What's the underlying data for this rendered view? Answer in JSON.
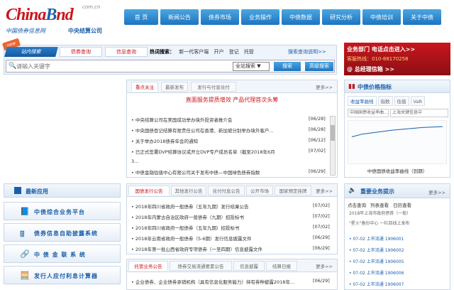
{
  "logo": {
    "main_a": "China",
    "main_b": "B",
    "main_c": "nd",
    "domain": "com.cn",
    "subtitle_left": "中国债券信息网",
    "subtitle_right": "中央结算公司"
  },
  "nav": {
    "items": [
      "首  页",
      "新闻公告",
      "债券市场",
      "业务操作",
      "中债数据",
      "研究分析",
      "中债培训",
      "关于中债"
    ]
  },
  "search": {
    "new_badge": "new",
    "tabs": [
      "站内搜索",
      "债券查询",
      "信息查询"
    ],
    "hot_label": "热词搜索：",
    "hot_terms": [
      "新一代客户端",
      "开户",
      "登记",
      "托管"
    ],
    "advanced_link": "搜索查询说明>>",
    "placeholder": "请输入关键字",
    "scope": "全站搜索 ▼",
    "search_button": "搜索",
    "advanced_button": "高级搜索"
  },
  "promo": {
    "line1": "业务部门 电话点击进入>>",
    "line2": "客服热线：010-88170258",
    "line3": "@ 总经理信箱 >>"
  },
  "apps": {
    "title": "最新应用",
    "items": [
      {
        "icon": "📘",
        "label": "中债综合业务平台"
      },
      {
        "icon": "🖩",
        "label": "债券信息自助披露系统"
      },
      {
        "icon": "🔗",
        "label": "中 债 金 联 系 统"
      },
      {
        "icon": "🧮",
        "label": "发行人应付利息计算器"
      }
    ]
  },
  "news": {
    "tabs": [
      "重点关注",
      "最新发布",
      "发行与付息兑付"
    ],
    "more": "更多>>",
    "banner": "直面服务提质增效 产品代理首次头筹",
    "rows": [
      {
        "text": "• 中央结算公司在美国成功举办境外投资者推介会",
        "date": "[06/28]"
      },
      {
        "text": "• 中央国债登记结算有限责任公司在香港、新加坡分别举办境外客户...",
        "date": "[06/28]"
      },
      {
        "text": "• 关于举办2018债券年会的通知",
        "date": "[06/12]"
      },
      {
        "text": "• 已正式签署DVP结算协议或开立DVP专户成员名单（截至2018年6月",
        "date": "[07/02]"
      },
      {
        "text": "  3..."
      },
      {
        "text": "• 中债金融估值中心有限公司关于发布中债—中国绿色债券指数",
        "date": "[06/29]"
      }
    ]
  },
  "notice": {
    "tabs": [
      "国债发行公告",
      "其他发行公告",
      "兑付付息公告",
      "公开市场",
      "国家预定挂牌",
      "更多>>"
    ],
    "rows": [
      {
        "text": "• 2018年四川省政府一般债券（五年九期）发行结果公告",
        "date": "[07/02]"
      },
      {
        "text": "• 2018年内蒙古自治区政府一般债券（九期）招投标书",
        "date": "[07/02]"
      },
      {
        "text": "• 2018年四川省政府一般债券（五年九期）招投标书",
        "date": "[07/02]"
      },
      {
        "text": "• 2018年云南省政府一般债券（5-6期）发行信息披露文件",
        "date": "[06/29]"
      },
      {
        "text": "• 2018年第一批山西省政府专项债券（一至四期）信息披露文件",
        "date": "[06/29]"
      }
    ]
  },
  "trust": {
    "tabs": [
      "托管业务公告",
      "债券交易流通要素公告",
      "信息披露",
      "结算日报",
      "更多>>"
    ],
    "rows": [
      {
        "text": "• 企业债券、企业债券承销机构（具有信息化服务能力）持有券种披露2018年...",
        "date": "[06/29]"
      }
    ]
  },
  "price": {
    "title": "中债价格指标",
    "tabs": [
      "收益率曲线",
      "指数",
      "估值",
      "VaR"
    ],
    "select1": "中国国债收益率曲...",
    "select2": "上海关键信息中",
    "caption": "中债国债收益率曲线（到期）",
    "ylim": [
      0,
      4
    ],
    "curve": [
      2.6,
      2.9,
      3.05,
      3.2,
      3.35,
      3.45,
      3.55,
      3.65,
      3.7,
      3.75
    ]
  },
  "biz": {
    "title": "重要业务提示",
    "more": "更多>>",
    "tabs": [
      "点击查询",
      "列表查看",
      "日历查看"
    ],
    "rows": [
      "2018年上海市政府债券（一般）",
      "\"星火\"备份中心 一栏目线上发布",
      "• 07-02 上市流通 1906001",
      "• 07-02 上市流通 1906002",
      "• 07-02 上市流通 1906005",
      "• 07-02 上市流通 1906006",
      "• 07-02 上市流通 1906007"
    ]
  },
  "colors": {
    "brand_red": "#c8161d",
    "brand_blue": "#1a5ea8",
    "nav_blue": "#1d74c1"
  }
}
